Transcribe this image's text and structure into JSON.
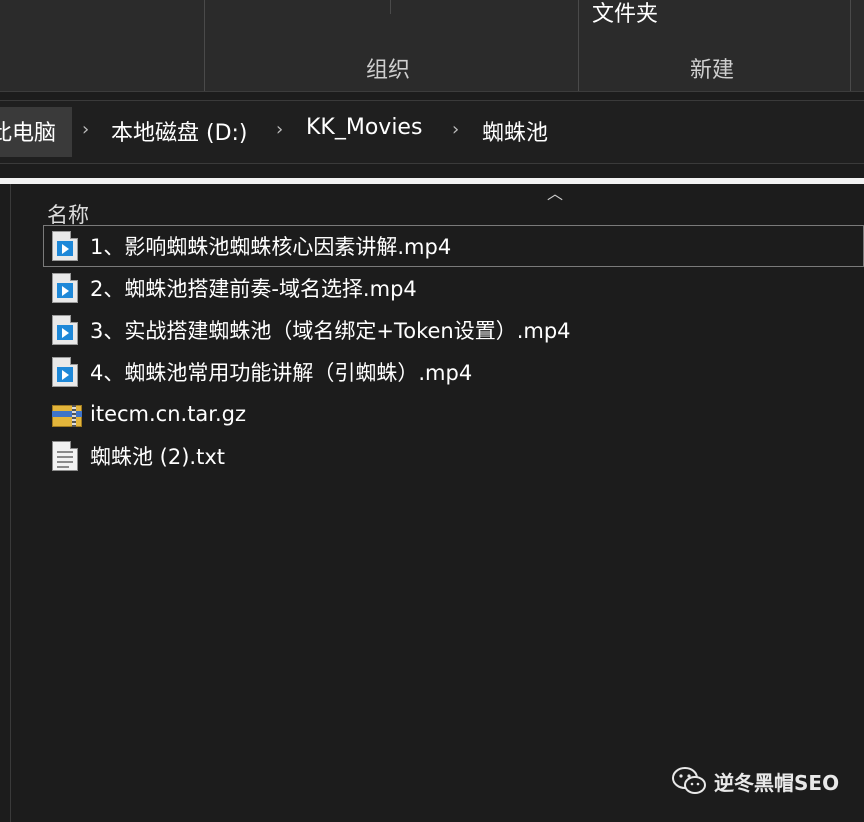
{
  "ribbon": {
    "folder_label": "文件夹",
    "group_organize": "组织",
    "group_new": "新建"
  },
  "breadcrumb": {
    "items": [
      "此电脑",
      "本地磁盘 (D:)",
      "KK_Movies",
      "蜘蛛池"
    ],
    "separator": "›"
  },
  "file_list": {
    "column_name": "名称",
    "files": [
      {
        "name": "1、影响蜘蛛池蜘蛛核心因素讲解.mp4",
        "icon": "video-file-icon"
      },
      {
        "name": "2、蜘蛛池搭建前奏-域名选择.mp4",
        "icon": "video-file-icon"
      },
      {
        "name": "3、实战搭建蜘蛛池（域名绑定+Token设置）.mp4",
        "icon": "video-file-icon"
      },
      {
        "name": "4、蜘蛛池常用功能讲解（引蜘蛛）.mp4",
        "icon": "video-file-icon"
      },
      {
        "name": "itecm.cn.tar.gz",
        "icon": "archive-file-icon"
      },
      {
        "name": "蜘蛛池 (2).txt",
        "icon": "text-file-icon"
      }
    ]
  },
  "watermark": {
    "text": "逆冬黑帽SEO",
    "icon": "wechat-icon"
  },
  "colors": {
    "background": "#1c1c1c",
    "ribbon": "#2b2b2b",
    "video_blue": "#1e88d8",
    "archive_yellow": "#e3b53b"
  }
}
